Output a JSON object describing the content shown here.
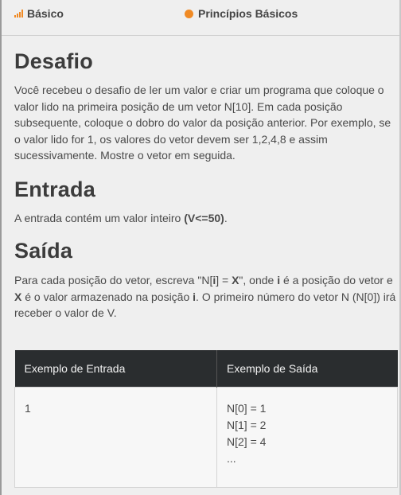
{
  "header": {
    "level_label": "Básico",
    "category_label": "Princípios Básicos",
    "accent_color": "#f08a24"
  },
  "sections": {
    "desafio": {
      "title": "Desafio",
      "text": "Você recebeu o desafio de ler um valor e criar um programa que coloque o valor lido na primeira posição de um vetor N[10]. Em cada posição subsequente, coloque o dobro do valor da posição anterior. Por exemplo, se o valor lido for 1, os valores do vetor devem ser 1,2,4,8 e assim sucessivamente. Mostre o vetor em seguida."
    },
    "entrada": {
      "title": "Entrada",
      "text_before": "A entrada contém um valor inteiro ",
      "text_bold": "(V<=50)",
      "text_after": "."
    },
    "saida": {
      "title": "Saída",
      "t1": "Para cada posição do vetor, escreva \"N[",
      "b1": "i",
      "t2": "] = ",
      "b2": "X",
      "t3": "\", onde ",
      "b3": "i",
      "t4": " é a posição do vetor e ",
      "b4": "X",
      "t5": " é o valor armazenado na posição ",
      "b5": "i",
      "t6": ". O primeiro número do vetor N (N[0]) irá receber o valor de V."
    }
  },
  "example_table": {
    "input_header": "Exemplo de Entrada",
    "output_header": "Exemplo de Saída",
    "input_value": "1",
    "output_lines": [
      "N[0] = 1",
      "N[1] = 2",
      "N[2] = 4",
      "..."
    ]
  }
}
